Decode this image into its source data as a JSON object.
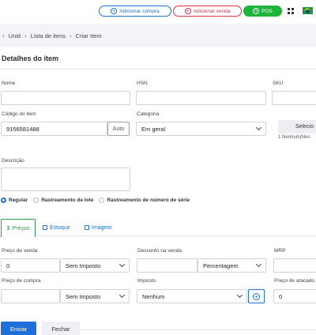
{
  "header": {
    "buy_label": "Adicionar compra",
    "sell_label": "Adicionar venda",
    "pos_label": "POS"
  },
  "breadcrumb": [
    "Unid",
    "Lista de itens",
    "Criar Item"
  ],
  "page_title": "Detalhes do item",
  "fields": {
    "name_label": "Nome",
    "hsn_label": "HSN",
    "sku_label": "SKU",
    "code_label": "Código do item",
    "code_value": "9156581488",
    "auto_label": "Auto",
    "category_label": "Categoria",
    "category_value": "Em geral",
    "select_label": "Selecio",
    "select_note": "1 Nenhum(Nen",
    "description_label": "Descrição"
  },
  "tracking": {
    "options": [
      "Regular",
      "Rastreamento de lote",
      "Rastreamento de número de série"
    ],
    "selected": "Regular"
  },
  "tabs": [
    "Preços",
    "Estoque",
    "Imagem"
  ],
  "pricing": {
    "sale_price_label": "Preço de venda",
    "sale_price_value": "0",
    "sale_tax_value": "Sem Imposto",
    "discount_label": "Desconto na venda",
    "discount_type_value": "Percentagem",
    "mrp_label": "MRP",
    "purchase_price_label": "Preço de compra",
    "purchase_tax_value": "Sem Imposto",
    "tax_label": "Imposto",
    "tax_value": "Nenhum",
    "wholesale_label": "Preço de atacado",
    "wholesale_value": "0"
  },
  "actions": {
    "save_label": "Enviar",
    "close_label": "Fechar"
  },
  "colors": {
    "primary": "#1e6fd9",
    "danger": "#e0304a",
    "success": "#1db43a"
  }
}
